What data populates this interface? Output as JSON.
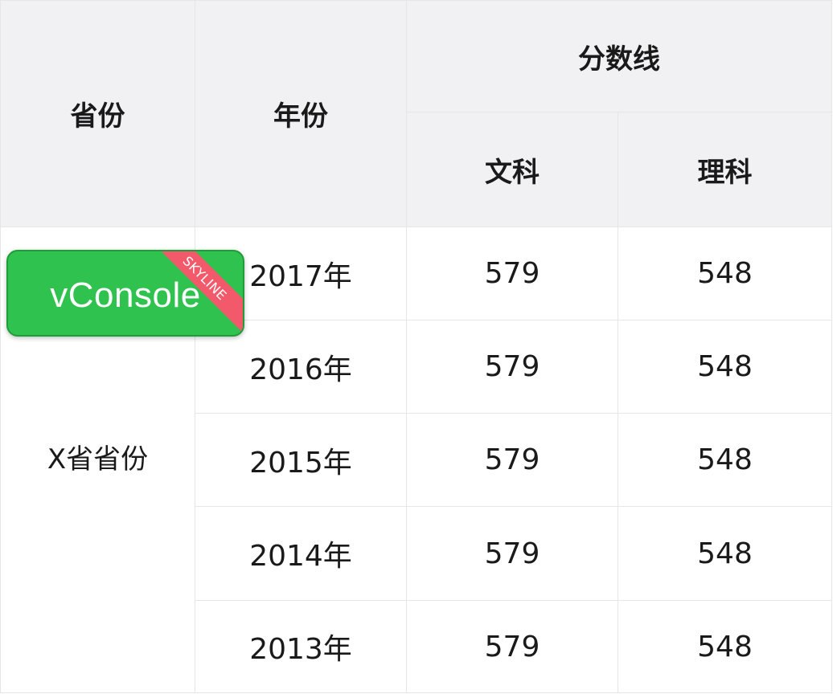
{
  "table": {
    "headers": {
      "province": "省份",
      "year": "年份",
      "score_line": "分数线",
      "arts": "文科",
      "science": "理科"
    },
    "province_value": "X省省份",
    "rows": [
      {
        "year": "2017年",
        "arts": "579",
        "science": "548"
      },
      {
        "year": "2016年",
        "arts": "579",
        "science": "548"
      },
      {
        "year": "2015年",
        "arts": "579",
        "science": "548"
      },
      {
        "year": "2014年",
        "arts": "579",
        "science": "548"
      },
      {
        "year": "2013年",
        "arts": "579",
        "science": "548"
      }
    ]
  },
  "vconsole": {
    "label": "vConsole",
    "ribbon": "SKYLINE",
    "color": "#2fc24e",
    "ribbon_color": "#f25a6b"
  }
}
